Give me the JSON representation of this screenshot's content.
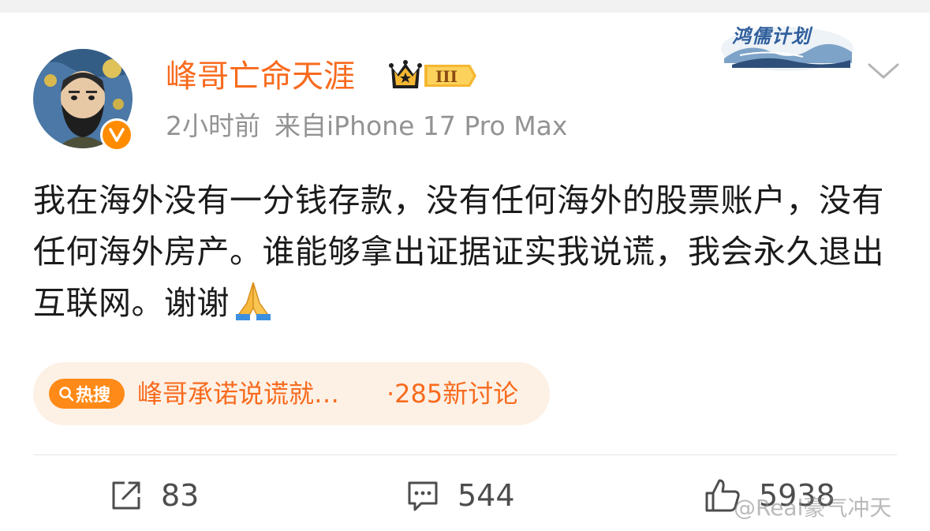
{
  "header": {
    "username": "峰哥亡命天涯",
    "level_badge": "III",
    "time": "2小时前",
    "source": "来自iPhone 17 Pro Max",
    "promo_label": "鸿儒计划"
  },
  "post": {
    "text": "我在海外没有一分钱存款，没有任何海外的股票账户，没有任何海外房产。谁能够拿出证据证实我说谎，我会永久退出互联网。谢谢",
    "emoji": "folded-hands-icon"
  },
  "hot_topic": {
    "tag_label": "热搜",
    "title": "峰哥承诺说谎就…",
    "count": "·285新讨论"
  },
  "actions": {
    "repost_count": "83",
    "comment_count": "544",
    "like_count": "5938"
  },
  "watermark": {
    "text": "@Real豪气冲天"
  },
  "colors": {
    "username": "#f86b1e",
    "meta": "#939393",
    "hot_bg": "#fdf1e6",
    "hot_accent": "#ff8a18"
  }
}
